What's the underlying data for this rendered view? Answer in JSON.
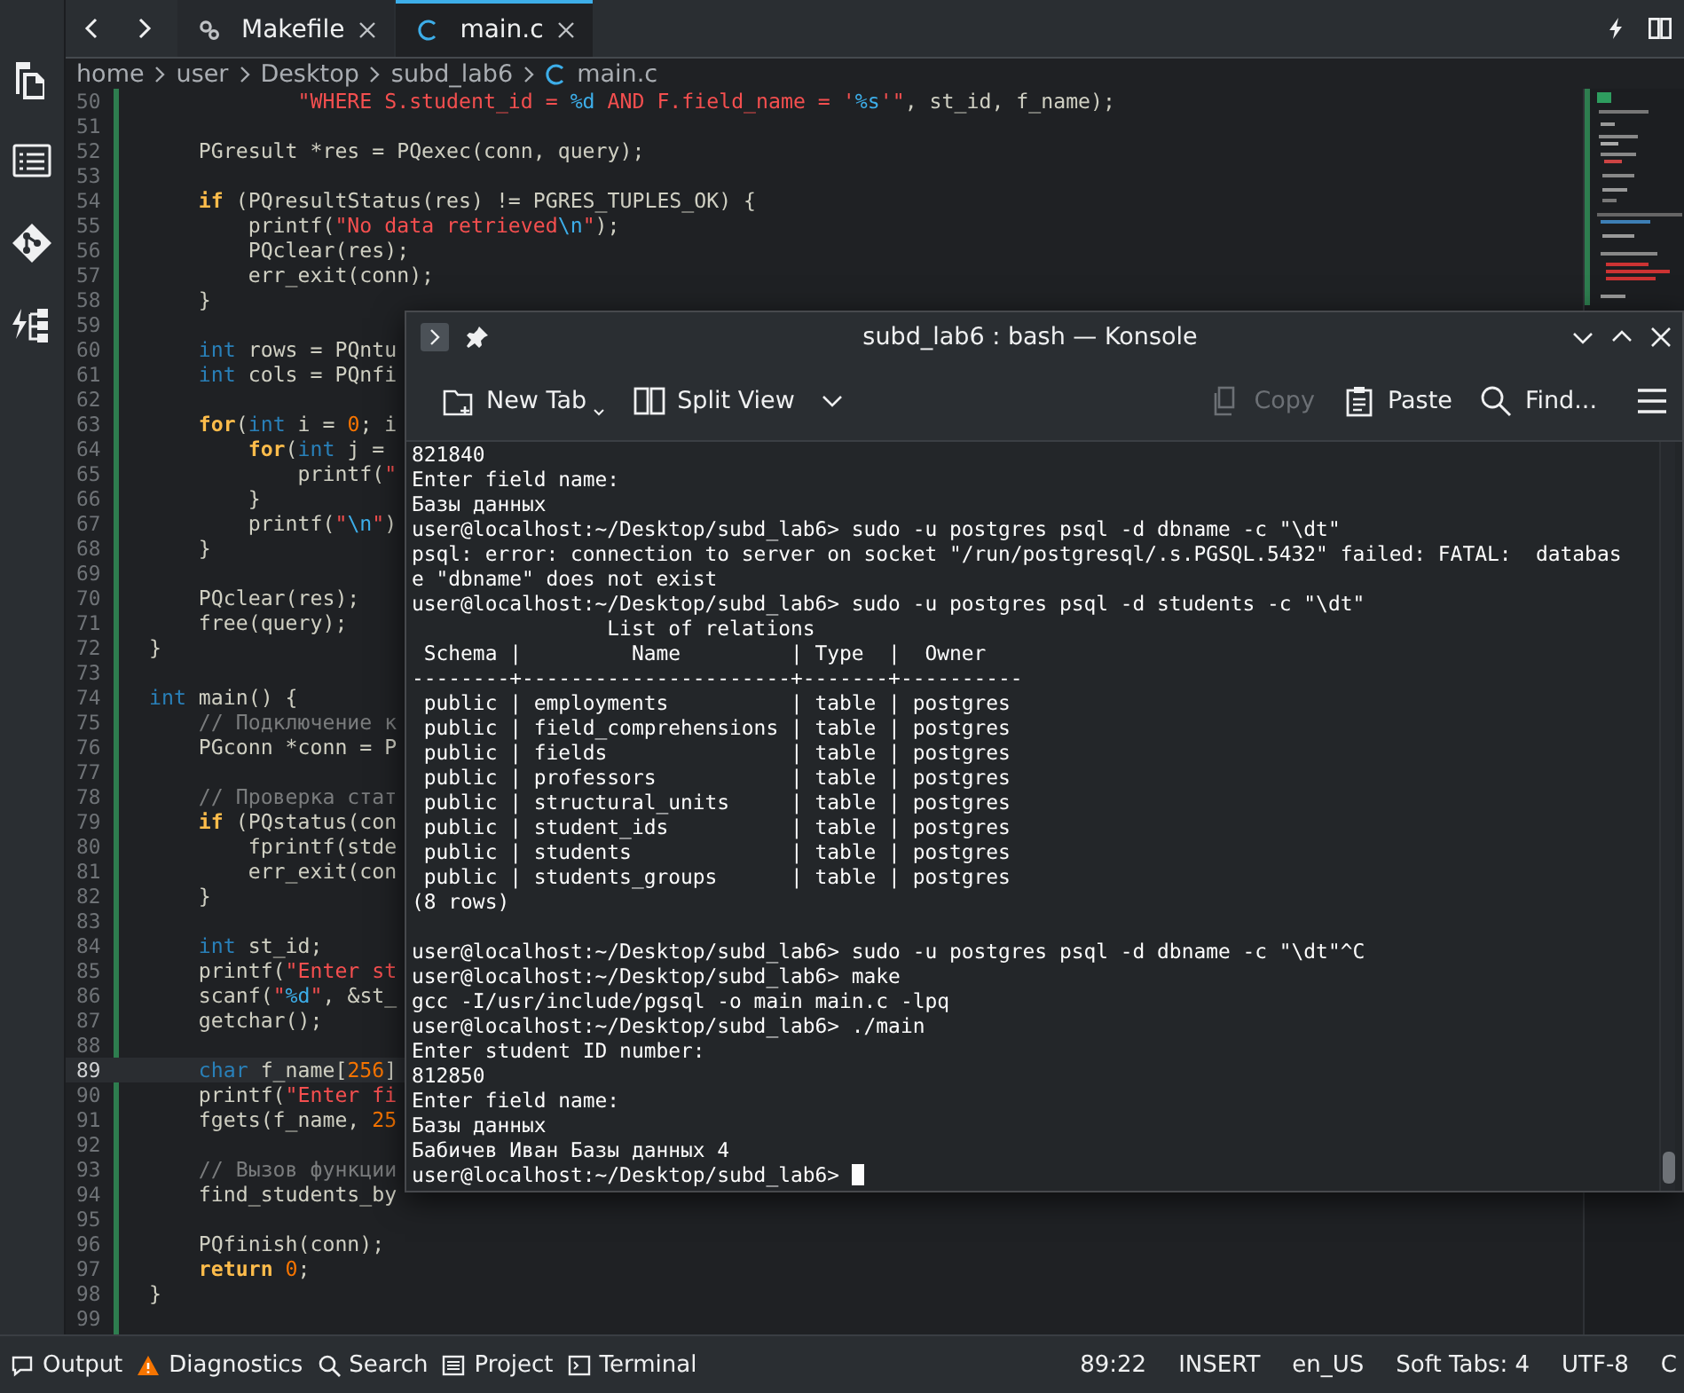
{
  "activity_bar": {
    "items": [
      {
        "kind": "documents",
        "selected": false
      },
      {
        "kind": "outline",
        "selected": false
      },
      {
        "kind": "git",
        "selected": false
      },
      {
        "kind": "build",
        "selected": false
      }
    ]
  },
  "tabs": [
    {
      "label": "Makefile",
      "kind": "makefile",
      "selected": false
    },
    {
      "label": "main.c",
      "kind": "c",
      "selected": true
    }
  ],
  "breadcrumb": [
    {
      "label": "home",
      "kind": "folder"
    },
    {
      "label": "user",
      "kind": "folder"
    },
    {
      "label": "Desktop",
      "kind": "folder"
    },
    {
      "label": "subd_lab6",
      "kind": "folder"
    },
    {
      "label": "main.c",
      "kind": "c"
    }
  ],
  "editor": {
    "lines": [
      {
        "number": "50",
        "current": false,
        "tokens": [
          {
            "text": "            \"WHERE S.student_id = ",
            "kind": "string"
          },
          {
            "text": "%d",
            "kind": "format"
          },
          {
            "text": " AND F.field_name = '",
            "kind": "string"
          },
          {
            "text": "%s",
            "kind": "format"
          },
          {
            "text": "'\"",
            "kind": "string"
          },
          {
            "text": ", st_id, f_name);",
            "kind": "plain"
          }
        ]
      },
      {
        "number": "51",
        "current": false
      },
      {
        "number": "52",
        "current": false,
        "tokens": [
          {
            "text": "    PGresult *res = PQexec(conn, query);",
            "kind": "plain"
          }
        ]
      },
      {
        "number": "53",
        "current": false
      },
      {
        "number": "54",
        "current": false,
        "tokens": [
          {
            "text": "    if",
            "kind": "keyword"
          },
          {
            "text": " (PQresultStatus(res) != PGRES_TUPLES_OK) {",
            "kind": "plain"
          }
        ]
      },
      {
        "number": "55",
        "current": false,
        "tokens": [
          {
            "text": "        printf(",
            "kind": "plain"
          },
          {
            "text": "\"No data retrieved",
            "kind": "string"
          },
          {
            "text": "\\n",
            "kind": "format"
          },
          {
            "text": "\"",
            "kind": "string"
          },
          {
            "text": ");",
            "kind": "plain"
          }
        ]
      },
      {
        "number": "56",
        "current": false,
        "tokens": [
          {
            "text": "        PQclear(res);",
            "kind": "plain"
          }
        ]
      },
      {
        "number": "57",
        "current": false,
        "tokens": [
          {
            "text": "        err_exit(conn);",
            "kind": "plain"
          }
        ]
      },
      {
        "number": "58",
        "current": false,
        "tokens": [
          {
            "text": "    }",
            "kind": "plain"
          }
        ]
      },
      {
        "number": "59",
        "current": false
      },
      {
        "number": "60",
        "current": false,
        "tokens": [
          {
            "text": "    int",
            "kind": "type"
          },
          {
            "text": " rows = PQntu",
            "kind": "plain"
          }
        ]
      },
      {
        "number": "61",
        "current": false,
        "tokens": [
          {
            "text": "    int",
            "kind": "type"
          },
          {
            "text": " cols = PQnfi",
            "kind": "plain"
          }
        ]
      },
      {
        "number": "62",
        "current": false
      },
      {
        "number": "63",
        "current": false,
        "tokens": [
          {
            "text": "    for",
            "kind": "keyword"
          },
          {
            "text": "(",
            "kind": "plain"
          },
          {
            "text": "int",
            "kind": "type"
          },
          {
            "text": " i = ",
            "kind": "plain"
          },
          {
            "text": "0",
            "kind": "number"
          },
          {
            "text": "; i",
            "kind": "plain"
          }
        ]
      },
      {
        "number": "64",
        "current": false,
        "tokens": [
          {
            "text": "        for",
            "kind": "keyword"
          },
          {
            "text": "(",
            "kind": "plain"
          },
          {
            "text": "int",
            "kind": "type"
          },
          {
            "text": " j =",
            "kind": "plain"
          }
        ]
      },
      {
        "number": "65",
        "current": false,
        "tokens": [
          {
            "text": "            printf(",
            "kind": "plain"
          },
          {
            "text": "\"",
            "kind": "string"
          }
        ]
      },
      {
        "number": "66",
        "current": false,
        "tokens": [
          {
            "text": "        }",
            "kind": "plain"
          }
        ]
      },
      {
        "number": "67",
        "current": false,
        "tokens": [
          {
            "text": "        printf(",
            "kind": "plain"
          },
          {
            "text": "\"",
            "kind": "string"
          },
          {
            "text": "\\n",
            "kind": "format"
          },
          {
            "text": "\"",
            "kind": "string"
          },
          {
            "text": ")",
            "kind": "plain"
          }
        ]
      },
      {
        "number": "68",
        "current": false,
        "tokens": [
          {
            "text": "    }",
            "kind": "plain"
          }
        ]
      },
      {
        "number": "69",
        "current": false
      },
      {
        "number": "70",
        "current": false,
        "tokens": [
          {
            "text": "    PQclear(res);",
            "kind": "plain"
          }
        ]
      },
      {
        "number": "71",
        "current": false,
        "tokens": [
          {
            "text": "    free(query);",
            "kind": "plain"
          }
        ]
      },
      {
        "number": "72",
        "current": false,
        "tokens": [
          {
            "text": "}",
            "kind": "plain"
          }
        ]
      },
      {
        "number": "73",
        "current": false
      },
      {
        "number": "74",
        "current": false,
        "tokens": [
          {
            "text": "int",
            "kind": "type"
          },
          {
            "text": " main() {",
            "kind": "plain"
          }
        ]
      },
      {
        "number": "75",
        "current": false,
        "tokens": [
          {
            "text": "    // Подключение к",
            "kind": "comment"
          }
        ]
      },
      {
        "number": "76",
        "current": false,
        "tokens": [
          {
            "text": "    PGconn *conn = P",
            "kind": "plain"
          }
        ]
      },
      {
        "number": "77",
        "current": false
      },
      {
        "number": "78",
        "current": false,
        "tokens": [
          {
            "text": "    // Проверка стат",
            "kind": "comment"
          }
        ]
      },
      {
        "number": "79",
        "current": false,
        "tokens": [
          {
            "text": "    if",
            "kind": "keyword"
          },
          {
            "text": " (PQstatus(con",
            "kind": "plain"
          }
        ]
      },
      {
        "number": "80",
        "current": false,
        "tokens": [
          {
            "text": "        fprintf(stde",
            "kind": "plain"
          }
        ]
      },
      {
        "number": "81",
        "current": false,
        "tokens": [
          {
            "text": "        err_exit(con",
            "kind": "plain"
          }
        ]
      },
      {
        "number": "82",
        "current": false,
        "tokens": [
          {
            "text": "    }",
            "kind": "plain"
          }
        ]
      },
      {
        "number": "83",
        "current": false
      },
      {
        "number": "84",
        "current": false,
        "tokens": [
          {
            "text": "    int",
            "kind": "type"
          },
          {
            "text": " st_id;",
            "kind": "plain"
          }
        ]
      },
      {
        "number": "85",
        "current": false,
        "tokens": [
          {
            "text": "    printf(",
            "kind": "plain"
          },
          {
            "text": "\"Enter st",
            "kind": "string"
          }
        ]
      },
      {
        "number": "86",
        "current": false,
        "tokens": [
          {
            "text": "    scanf(",
            "kind": "plain"
          },
          {
            "text": "\"",
            "kind": "string"
          },
          {
            "text": "%d",
            "kind": "format"
          },
          {
            "text": "\"",
            "kind": "string"
          },
          {
            "text": ", &st_",
            "kind": "plain"
          }
        ]
      },
      {
        "number": "87",
        "current": false,
        "tokens": [
          {
            "text": "    getchar();",
            "kind": "plain"
          }
        ]
      },
      {
        "number": "88",
        "current": false
      },
      {
        "number": "89",
        "current": true,
        "tokens": [
          {
            "text": "    char",
            "kind": "type"
          },
          {
            "text": " f_name[",
            "kind": "plain"
          },
          {
            "text": "256",
            "kind": "number"
          },
          {
            "text": "]",
            "kind": "plain"
          }
        ]
      },
      {
        "number": "90",
        "current": false,
        "tokens": [
          {
            "text": "    printf(",
            "kind": "plain"
          },
          {
            "text": "\"Enter fi",
            "kind": "string"
          }
        ]
      },
      {
        "number": "91",
        "current": false,
        "tokens": [
          {
            "text": "    fgets(f_name, ",
            "kind": "plain"
          },
          {
            "text": "25",
            "kind": "number"
          }
        ]
      },
      {
        "number": "92",
        "current": false
      },
      {
        "number": "93",
        "current": false,
        "tokens": [
          {
            "text": "    // Вызов функции",
            "kind": "comment"
          }
        ]
      },
      {
        "number": "94",
        "current": false,
        "tokens": [
          {
            "text": "    find_students_by",
            "kind": "plain"
          }
        ]
      },
      {
        "number": "95",
        "current": false
      },
      {
        "number": "96",
        "current": false,
        "tokens": [
          {
            "text": "    PQfinish(conn);",
            "kind": "plain"
          }
        ]
      },
      {
        "number": "97",
        "current": false,
        "tokens": [
          {
            "text": "    return",
            "kind": "keyword"
          },
          {
            "text": " 0",
            "kind": "number"
          },
          {
            "text": ";",
            "kind": "plain"
          }
        ]
      },
      {
        "number": "98",
        "current": false,
        "tokens": [
          {
            "text": "}",
            "kind": "plain"
          }
        ]
      },
      {
        "number": "99",
        "current": false
      }
    ]
  },
  "konsole": {
    "title": "subd_lab6 : bash — Konsole",
    "toolbar": [
      {
        "label": "New Tab",
        "kind": "new-tab",
        "disabled": false
      },
      {
        "label": "Split View",
        "kind": "split-view",
        "disabled": false
      },
      {
        "label": "Copy",
        "kind": "copy",
        "disabled": true
      },
      {
        "label": "Paste",
        "kind": "paste",
        "disabled": false
      },
      {
        "label": "Find...",
        "kind": "find",
        "disabled": false
      }
    ],
    "output_blocks": [
      {
        "lines": [
          "821840",
          "Enter field name:",
          "Базы данных",
          "user@localhost:~/Desktop/subd_lab6> sudo -u postgres psql -d dbname -c \"\\dt\"",
          "psql: error: connection to server on socket \"/run/postgresql/.s.PGSQL.5432\" failed: FATAL:  databas",
          "e \"dbname\" does not exist",
          "user@localhost:~/Desktop/subd_lab6> sudo -u postgres psql -d students -c \"\\dt\"",
          "                List of relations",
          " Schema |         Name         | Type  |  Owner",
          "--------+----------------------+-------+----------",
          " public | employments          | table | postgres",
          " public | field_comprehensions | table | postgres",
          " public | fields               | table | postgres",
          " public | professors           | table | postgres",
          " public | structural_units     | table | postgres",
          " public | student_ids          | table | postgres",
          " public | students             | table | postgres",
          " public | students_groups      | table | postgres",
          "(8 rows)"
        ]
      },
      {
        "lines": [
          "user@localhost:~/Desktop/subd_lab6> sudo -u postgres psql -d dbname -c \"\\dt\"^C",
          "user@localhost:~/Desktop/subd_lab6> make",
          "gcc -I/usr/include/pgsql -o main main.c -lpq",
          "user@localhost:~/Desktop/subd_lab6> ./main",
          "Enter student ID number:",
          "812850",
          "Enter field name:",
          "Базы данных",
          "Бабичев Иван Базы данных 4",
          "user@localhost:~/Desktop/subd_lab6> "
        ]
      }
    ]
  },
  "status_bar": {
    "panels": [
      {
        "label": "Output",
        "kind": "output"
      },
      {
        "label": "Diagnostics",
        "kind": "diagnostics"
      },
      {
        "label": "Search",
        "kind": "search"
      },
      {
        "label": "Project",
        "kind": "project"
      },
      {
        "label": "Terminal",
        "kind": "terminal"
      }
    ],
    "info": [
      "89:22",
      "INSERT",
      "en_US",
      "Soft Tabs: 4",
      "UTF-8",
      "C"
    ]
  }
}
